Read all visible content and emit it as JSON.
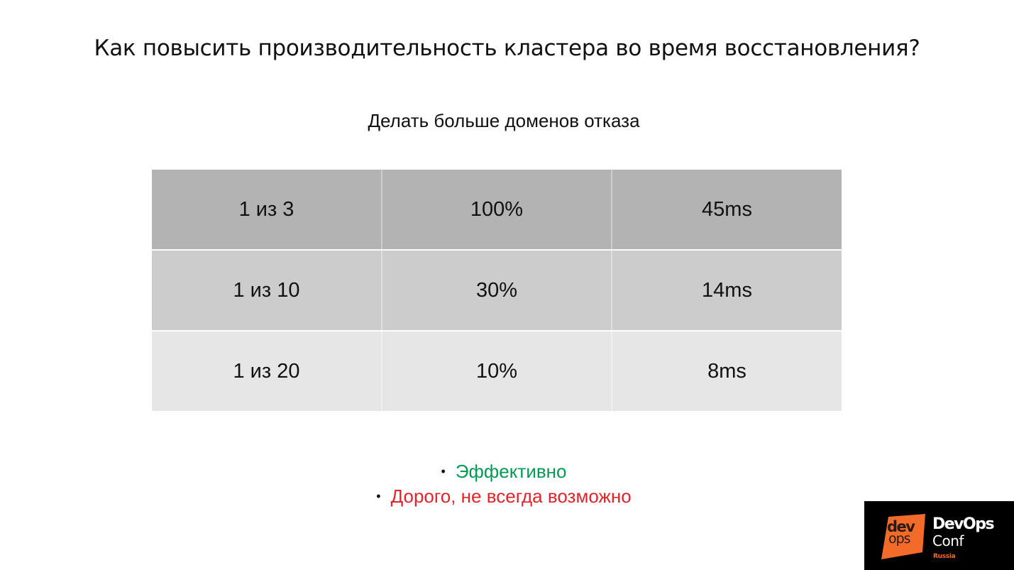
{
  "slide": {
    "title": "Как повысить производительность кластера во время восстановления?",
    "subtitle": "Делать больше доменов отказа"
  },
  "table": {
    "rows": [
      [
        "1 из 3",
        "100%",
        "45ms"
      ],
      [
        "1 из 10",
        "30%",
        "14ms"
      ],
      [
        "1 из 20",
        "10%",
        "8ms"
      ]
    ]
  },
  "bullets": {
    "marker": "•",
    "good": "Эффективно",
    "bad": "Дорого, не всегда возможно"
  },
  "logo": {
    "mark_top": "dev",
    "mark_bottom": "ops",
    "name": "DevOps",
    "conf": "Conf",
    "region": "Russia"
  },
  "colors": {
    "good": "#009a55",
    "bad": "#e2232a",
    "logo_orange": "#f26b2a",
    "row_header": "#b3b3b3",
    "row_mid": "#cccccc",
    "row_light": "#e6e6e6"
  }
}
